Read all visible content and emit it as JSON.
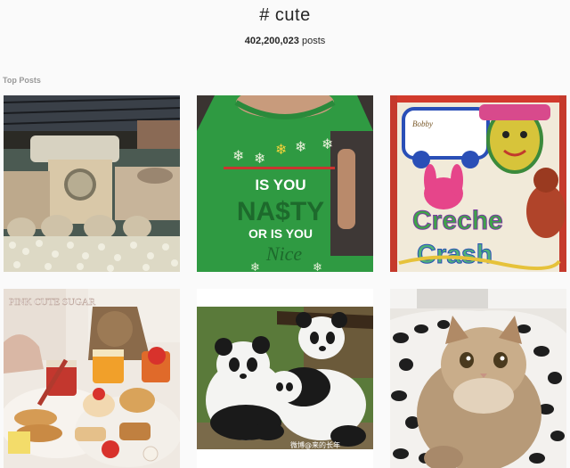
{
  "hashtag": {
    "title": "# cute",
    "post_count": "402,200,023",
    "post_suffix": " posts"
  },
  "sections": {
    "top_posts_label": "Top Posts"
  },
  "posts": [
    {
      "subject": "hamster-cage",
      "overlay_text": ""
    },
    {
      "subject": "sweater-tshirt",
      "shirt_lines": [
        "IS YOU",
        "NA$TY",
        "OR IS YOU",
        "Nice"
      ]
    },
    {
      "subject": "crayon-drawing",
      "drawing_text": [
        "Bobby",
        "Creche",
        "Crash"
      ]
    },
    {
      "subject": "miniature-food",
      "watermark": "PINK CUTE SUGAR"
    },
    {
      "subject": "pandas",
      "caption": "微博@来的长年"
    },
    {
      "subject": "fluffy-cat"
    }
  ],
  "colors": {
    "background": "#fafafa",
    "label_gray": "#999999",
    "text": "#262626"
  }
}
